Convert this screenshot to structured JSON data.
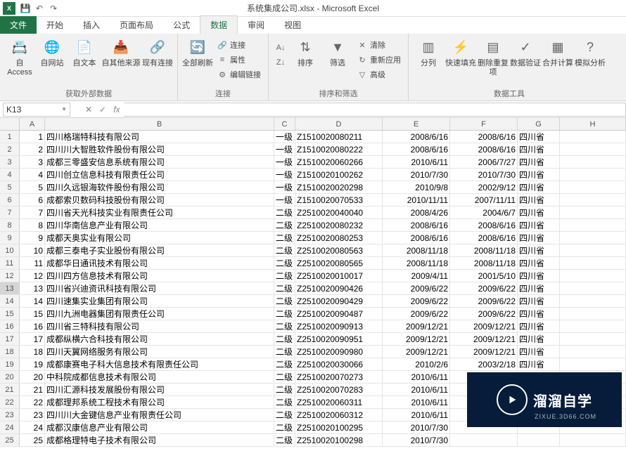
{
  "title": "系统集成公司.xlsx - Microsoft Excel",
  "tabs": {
    "file": "文件",
    "home": "开始",
    "insert": "插入",
    "layout": "页面布局",
    "formulas": "公式",
    "data": "数据",
    "review": "审阅",
    "view": "视图"
  },
  "ribbon": {
    "ext": {
      "access": "自 Access",
      "web": "自网站",
      "text": "自文本",
      "other": "自其他来源",
      "existing": "现有连接",
      "label": "获取外部数据"
    },
    "conn": {
      "refresh": "全部刷新",
      "conn": "连接",
      "prop": "属性",
      "edit": "编辑链接",
      "label": "连接"
    },
    "sort": {
      "sort": "排序",
      "filter": "筛选",
      "clear": "清除",
      "reapply": "重新应用",
      "adv": "高级",
      "label": "排序和筛选"
    },
    "tools": {
      "t2c": "分列",
      "flash": "快速填充",
      "dedup": "删除重复项",
      "dv": "数据验证",
      "consol": "合并计算",
      "whatif": "模拟分析",
      "label": "数据工具"
    }
  },
  "namebox": "K13",
  "columns": [
    "A",
    "B",
    "C",
    "D",
    "E",
    "F",
    "G",
    "H"
  ],
  "rows": [
    {
      "n": 1,
      "A": "1",
      "B": "四川格瑞特科技有限公司",
      "C": "一级",
      "D": "Z1510020080211",
      "E": "2008/6/16",
      "F": "2008/6/16",
      "G": "四川省"
    },
    {
      "n": 2,
      "A": "2",
      "B": "四川川大智胜软件股份有限公司",
      "C": "一级",
      "D": "Z1510020080222",
      "E": "2008/6/16",
      "F": "2008/6/16",
      "G": "四川省"
    },
    {
      "n": 3,
      "A": "3",
      "B": "成都三零盛安信息系统有限公司",
      "C": "一级",
      "D": "Z1510020060266",
      "E": "2010/6/11",
      "F": "2006/7/27",
      "G": "四川省"
    },
    {
      "n": 4,
      "A": "4",
      "B": "四川创立信息科技有限责任公司",
      "C": "一级",
      "D": "Z1510020100262",
      "E": "2010/7/30",
      "F": "2010/7/30",
      "G": "四川省"
    },
    {
      "n": 5,
      "A": "5",
      "B": "四川久远银海软件股份有限公司",
      "C": "一级",
      "D": "Z1510020020298",
      "E": "2010/9/8",
      "F": "2002/9/12",
      "G": "四川省"
    },
    {
      "n": 6,
      "A": "6",
      "B": "成都索贝数码科技股份有限公司",
      "C": "一级",
      "D": "Z1510020070533",
      "E": "2010/11/11",
      "F": "2007/11/11",
      "G": "四川省"
    },
    {
      "n": 7,
      "A": "7",
      "B": "四川省天光科技实业有限责任公司",
      "C": "二级",
      "D": "Z2510020040040",
      "E": "2008/4/26",
      "F": "2004/6/7",
      "G": "四川省"
    },
    {
      "n": 8,
      "A": "8",
      "B": "四川华南信息产业有限公司",
      "C": "二级",
      "D": "Z2510020080232",
      "E": "2008/6/16",
      "F": "2008/6/16",
      "G": "四川省"
    },
    {
      "n": 9,
      "A": "9",
      "B": "成都天奥实业有限公司",
      "C": "二级",
      "D": "Z2510020080253",
      "E": "2008/6/16",
      "F": "2008/6/16",
      "G": "四川省"
    },
    {
      "n": 10,
      "A": "10",
      "B": "成都三泰电子实业股份有限公司",
      "C": "二级",
      "D": "Z2510020080563",
      "E": "2008/11/18",
      "F": "2008/11/18",
      "G": "四川省"
    },
    {
      "n": 11,
      "A": "11",
      "B": "成都华日通讯技术有限公司",
      "C": "二级",
      "D": "Z2510020080565",
      "E": "2008/11/18",
      "F": "2008/11/18",
      "G": "四川省"
    },
    {
      "n": 12,
      "A": "12",
      "B": "四川四方信息技术有限公司",
      "C": "二级",
      "D": "Z2510020010017",
      "E": "2009/4/11",
      "F": "2001/5/10",
      "G": "四川省"
    },
    {
      "n": 13,
      "A": "13",
      "B": "四川省兴迪资讯科技有限公司",
      "C": "二级",
      "D": "Z2510020090426",
      "E": "2009/6/22",
      "F": "2009/6/22",
      "G": "四川省",
      "active": true
    },
    {
      "n": 14,
      "A": "14",
      "B": "四川速集实业集团有限公司",
      "C": "二级",
      "D": "Z2510020090429",
      "E": "2009/6/22",
      "F": "2009/6/22",
      "G": "四川省"
    },
    {
      "n": 15,
      "A": "15",
      "B": "四川九洲电器集团有限责任公司",
      "C": "二级",
      "D": "Z2510020090487",
      "E": "2009/6/22",
      "F": "2009/6/22",
      "G": "四川省"
    },
    {
      "n": 16,
      "A": "16",
      "B": "四川省三特科技有限公司",
      "C": "二级",
      "D": "Z2510020090913",
      "E": "2009/12/21",
      "F": "2009/12/21",
      "G": "四川省"
    },
    {
      "n": 17,
      "A": "17",
      "B": "成都纵横六合科技有限公司",
      "C": "二级",
      "D": "Z2510020090951",
      "E": "2009/12/21",
      "F": "2009/12/21",
      "G": "四川省"
    },
    {
      "n": 18,
      "A": "18",
      "B": "四川天翼网络服务有限公司",
      "C": "二级",
      "D": "Z2510020090980",
      "E": "2009/12/21",
      "F": "2009/12/21",
      "G": "四川省"
    },
    {
      "n": 19,
      "A": "19",
      "B": "成都康赛电子科大信息技术有限责任公司",
      "C": "二级",
      "D": "Z2510020030066",
      "E": "2010/2/6",
      "F": "2003/2/18",
      "G": "四川省"
    },
    {
      "n": 20,
      "A": "20",
      "B": "中科院成都信息技术有限公司",
      "C": "二级",
      "D": "Z2510020070273",
      "E": "2010/6/11",
      "F": "",
      "G": ""
    },
    {
      "n": 21,
      "A": "21",
      "B": "四川汇源科技发展股份有限公司",
      "C": "二级",
      "D": "Z2510020070283",
      "E": "2010/6/11",
      "F": "",
      "G": ""
    },
    {
      "n": 22,
      "A": "22",
      "B": "成都理邦系统工程技术有限公司",
      "C": "二级",
      "D": "Z2510020060311",
      "E": "2010/6/11",
      "F": "",
      "G": ""
    },
    {
      "n": 23,
      "A": "23",
      "B": "四川川大金键信息产业有限责任公司",
      "C": "二级",
      "D": "Z2510020060312",
      "E": "2010/6/11",
      "F": "",
      "G": ""
    },
    {
      "n": 24,
      "A": "24",
      "B": "成都汉康信息产业有限公司",
      "C": "二级",
      "D": "Z2510020100295",
      "E": "2010/7/30",
      "F": "",
      "G": ""
    },
    {
      "n": 25,
      "A": "25",
      "B": "成都格理特电子技术有限公司",
      "C": "二级",
      "D": "Z2510020100298",
      "E": "2010/7/30",
      "F": "",
      "G": ""
    }
  ],
  "watermark": {
    "brand": "溜溜自学",
    "url": "ZIXUE.3D66.COM"
  }
}
